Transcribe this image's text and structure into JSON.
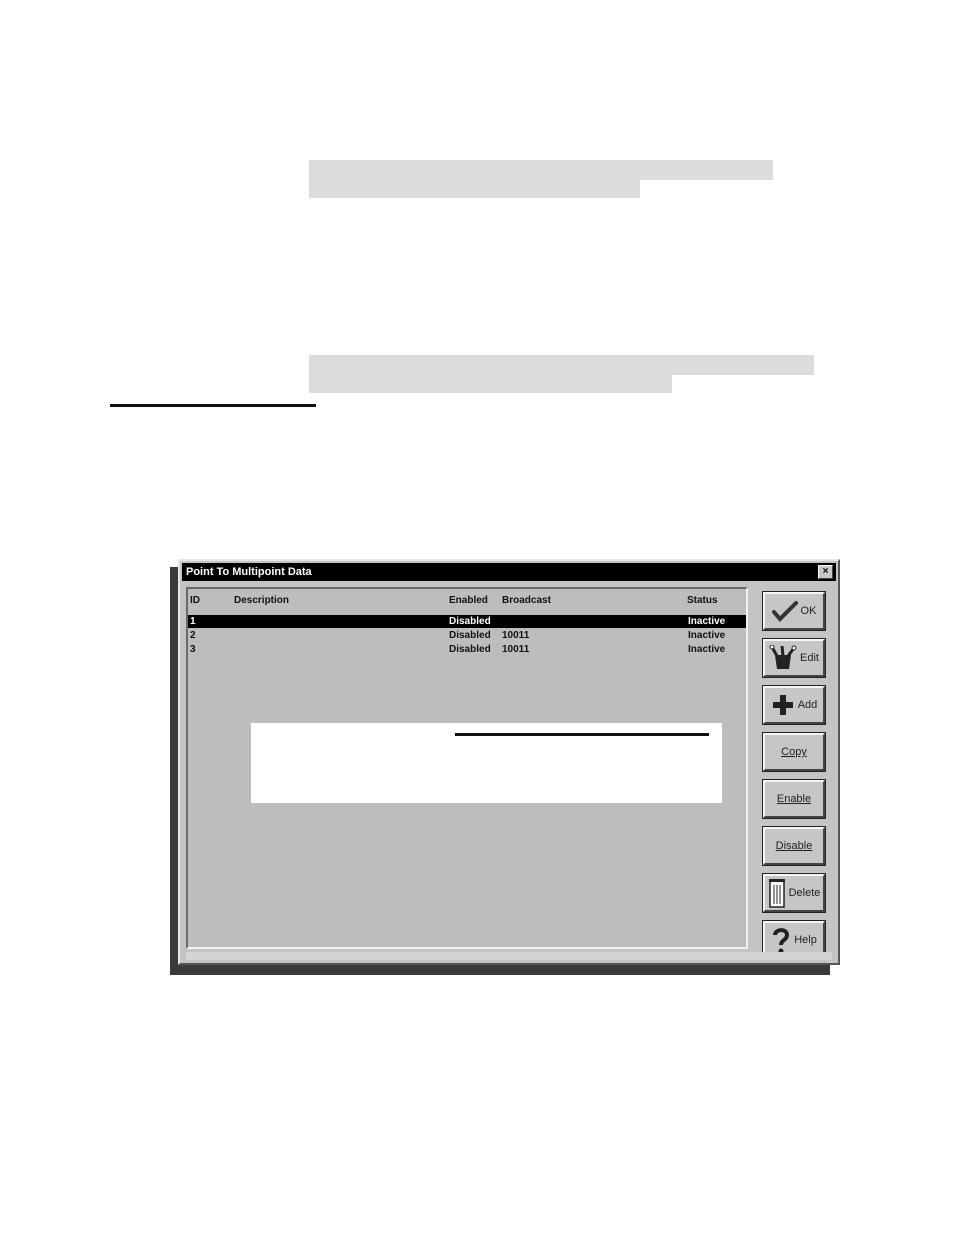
{
  "window": {
    "title": "Point To Multipoint Data",
    "close_glyph": "×"
  },
  "columns": {
    "id": "ID",
    "description": "Description",
    "enabled": "Enabled",
    "broadcast": "Broadcast",
    "status": "Status"
  },
  "rows": [
    {
      "id": "1",
      "description": "",
      "enabled": "Disabled",
      "broadcast": "",
      "status": "Inactive",
      "selected": true
    },
    {
      "id": "2",
      "description": "",
      "enabled": "Disabled",
      "broadcast": "10011",
      "status": "Inactive",
      "selected": false
    },
    {
      "id": "3",
      "description": "",
      "enabled": "Disabled",
      "broadcast": "10011",
      "status": "Inactive",
      "selected": false
    }
  ],
  "buttons": {
    "ok": {
      "label": "OK",
      "icon": "checkmark-icon"
    },
    "edit": {
      "label": "Edit",
      "icon": "edit-tools-icon"
    },
    "add": {
      "label": "Add",
      "icon": "plus-icon"
    },
    "copy": {
      "label": "Copy"
    },
    "enable": {
      "label": "Enable"
    },
    "disable": {
      "label": "Disable"
    },
    "delete": {
      "label": "Delete",
      "icon": "trash-icon"
    },
    "help": {
      "label": "Help",
      "icon": "question-icon"
    }
  },
  "colors": {
    "titlebar": "#000000",
    "dialog_bg": "#c4c4c4",
    "selection": "#000000"
  }
}
